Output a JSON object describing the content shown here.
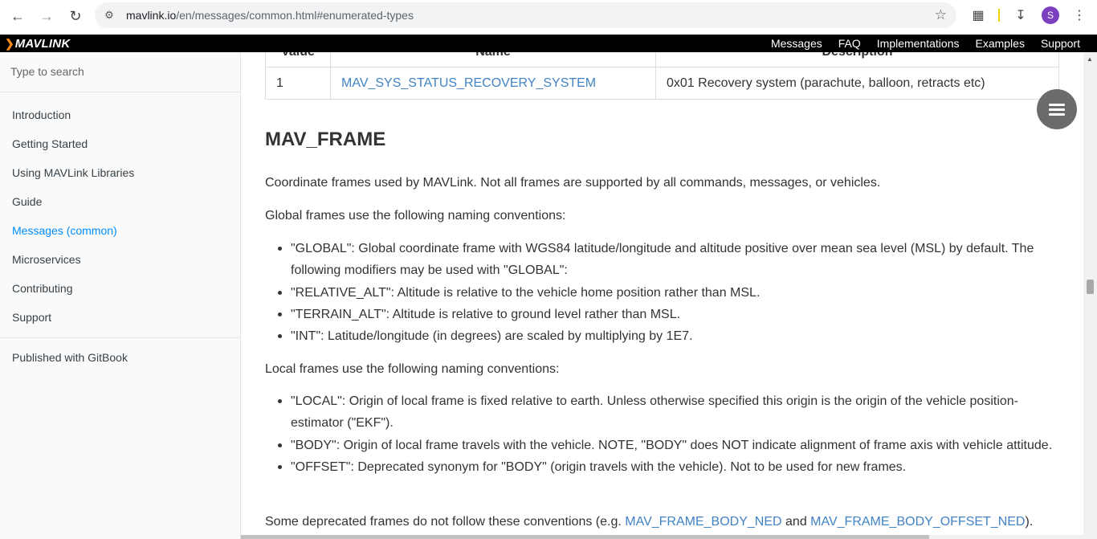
{
  "browser": {
    "url_host": "mavlink.io",
    "url_path": "/en/messages/common.html#enumerated-types",
    "profile_initial": "S"
  },
  "site": {
    "logo_text": "MAVLINK",
    "nav": [
      "Messages",
      "FAQ",
      "Implementations",
      "Examples",
      "Support"
    ]
  },
  "sidebar": {
    "search_placeholder": "Type to search",
    "items": [
      {
        "label": "Introduction"
      },
      {
        "label": "Getting Started"
      },
      {
        "label": "Using MAVLink Libraries"
      },
      {
        "label": "Guide"
      },
      {
        "label": "Messages (common)",
        "active": true
      },
      {
        "label": "Microservices"
      },
      {
        "label": "Contributing"
      },
      {
        "label": "Support"
      }
    ],
    "published": "Published with GitBook"
  },
  "table": {
    "headers": [
      "Value",
      "Name",
      "Description"
    ],
    "row": {
      "value": "1",
      "name": "MAV_SYS_STATUS_RECOVERY_SYSTEM",
      "description": "0x01 Recovery system (parachute, balloon, retracts etc)"
    }
  },
  "content": {
    "heading": "MAV_FRAME",
    "intro": "Coordinate frames used by MAVLink. Not all frames are supported by all commands, messages, or vehicles.",
    "global_intro": "Global frames use the following naming conventions:",
    "global_items": [
      "\"GLOBAL\": Global coordinate frame with WGS84 latitude/longitude and altitude positive over mean sea level (MSL) by default. The following modifiers may be used with \"GLOBAL\":",
      "\"RELATIVE_ALT\": Altitude is relative to the vehicle home position rather than MSL.",
      "\"TERRAIN_ALT\": Altitude is relative to ground level rather than MSL.",
      "\"INT\": Latitude/longitude (in degrees) are scaled by multiplying by 1E7."
    ],
    "local_intro": "Local frames use the following naming conventions:",
    "local_items": [
      "\"LOCAL\": Origin of local frame is fixed relative to earth. Unless otherwise specified this origin is the origin of the vehicle position-estimator (\"EKF\").",
      "\"BODY\": Origin of local frame travels with the vehicle. NOTE, \"BODY\" does NOT indicate alignment of frame axis with vehicle attitude.",
      "\"OFFSET\": Deprecated synonym for \"BODY\" (origin travels with the vehicle). Not to be used for new frames."
    ],
    "deprecated_prefix": "Some deprecated frames do not follow these conventions (e.g. ",
    "deprecated_link1": "MAV_FRAME_BODY_NED",
    "deprecated_and": " and ",
    "deprecated_link2": "MAV_FRAME_BODY_OFFSET_NED",
    "deprecated_suffix": ")."
  },
  "colors": {
    "link": "#4183c4",
    "active_nav": "#008cff",
    "logo_accent": "#f48a1c"
  }
}
